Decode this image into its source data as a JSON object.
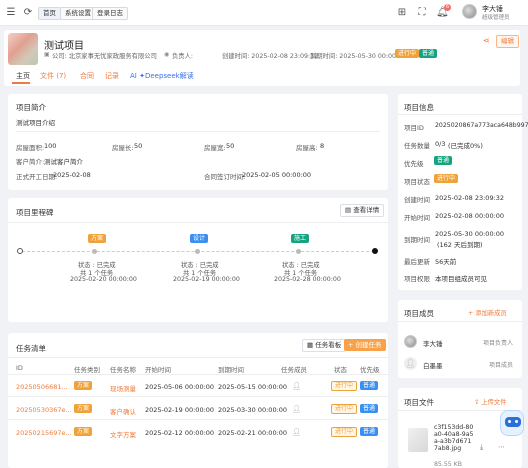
{
  "topbar": {
    "tabs": [
      "首页",
      "系统设置",
      "登录日志"
    ],
    "notification_count": "6",
    "user_name": "李大锤",
    "user_role": "超级管理员"
  },
  "project": {
    "name": "测试项目",
    "company": "公司: 北京家事无忧家政服务有限公司",
    "owner": "负责人:",
    "created": "创建时间: 2025-02-08 23:09:32",
    "due": "到期时间: 2025-05-30 00:00:00",
    "status": "进行中",
    "priority": "普通",
    "edit_label": "编辑"
  },
  "tabs": [
    "主页",
    "文件 (7)",
    "合同",
    "记录",
    "AI ✦Deepseek解读"
  ],
  "intro": {
    "title": "项目简介",
    "text": "测试项目介绍",
    "area_label": "房屋面积:",
    "area_value": "100",
    "length_label": "房屋长:",
    "length_value": "50",
    "width_label": "房屋宽:",
    "width_value": "50",
    "height_label": "房屋高:",
    "height_value": "8",
    "customer_label": "客户简介:",
    "customer_value": "测试客户简介",
    "start_label": "正式开工日期:",
    "start_value": "2025-02-08",
    "contract_label": "合同签订时间:",
    "contract_value": "2025-02-05 00:00:00"
  },
  "milestones": {
    "title": "项目里程碑",
    "view_button": "查看详情",
    "items": [
      {
        "tag": "方案",
        "status": "状态 : 已完成",
        "count": "共 1 个任务",
        "date": "2025-02-20 00:00:00"
      },
      {
        "tag": "设计",
        "status": "状态 : 已完成",
        "count": "共 1 个任务",
        "date": "2025-02-19 00:00:00"
      },
      {
        "tag": "施工",
        "status": "状态 : 已完成",
        "count": "共 1 个任务",
        "date": "2025-02-28 00:00:00"
      }
    ]
  },
  "tasks": {
    "title": "任务清单",
    "kanban_button": "任务看板",
    "create_button": "+ 创建任务",
    "headers": [
      "ID",
      "任务类别",
      "任务名称",
      "开始时间",
      "到期时间",
      "任务成员",
      "状态",
      "优先级"
    ],
    "rows": [
      {
        "id": "20250506681...",
        "category": "方案",
        "name": "现场测量",
        "start": "2025-05-06 00:00:00",
        "end": "2025-05-15 00:00:00",
        "status": "进行中",
        "priority": "普通"
      },
      {
        "id": "20250530367e...",
        "category": "方案",
        "name": "客户确认",
        "start": "2025-02-19 00:00:00",
        "end": "2025-03-30 00:00:00",
        "status": "进行中",
        "priority": "普通"
      },
      {
        "id": "20250215697e...",
        "category": "方案",
        "name": "文字方案",
        "start": "2025-02-12 00:00:00",
        "end": "2025-02-21 00:00:00",
        "status": "进行中",
        "priority": "普通"
      }
    ]
  },
  "info": {
    "title": "项目信息",
    "rows": [
      {
        "label": "项目ID",
        "value": "2025020867a773aca648b997"
      },
      {
        "label": "任务数量",
        "value": "0/3",
        "extra": "(已完成0%)"
      },
      {
        "label": "优先级",
        "value": "普通"
      },
      {
        "label": "项目状态",
        "value": "进行中"
      },
      {
        "label": "创建时间",
        "value": "2025-02-08 23:09:32"
      },
      {
        "label": "开始时间",
        "value": "2025-02-08 00:00:00"
      },
      {
        "label": "到期时间",
        "value": "2025-05-30 00:00:00",
        "extra": "(162 天后到期)"
      },
      {
        "label": "最后更新",
        "value": "56天前"
      },
      {
        "label": "项目权限",
        "value": "本项目组成员可见"
      }
    ]
  },
  "members": {
    "title": "项目成员",
    "add_button": "+ 添加新成员",
    "list": [
      {
        "name": "李大锤",
        "role": "项目负责人"
      },
      {
        "name": "白墨墨",
        "role": "项目成员"
      }
    ]
  },
  "files": {
    "title": "项目文件",
    "upload_button": "上传文件",
    "file_name": "c3f153dd-80a0-40a8-9a5a-a3b7d6717ab8.jpg",
    "file_size": "85.55 KB"
  }
}
